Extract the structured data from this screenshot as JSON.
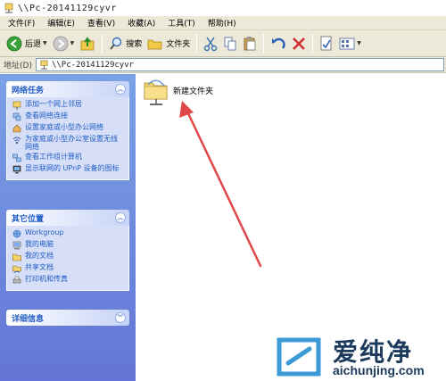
{
  "window": {
    "title": "\\\\Pc-20141129cyvr"
  },
  "menu": {
    "items": [
      "文件(F)",
      "编辑(E)",
      "查看(V)",
      "收藏(A)",
      "工具(T)",
      "帮助(H)"
    ]
  },
  "toolbar": {
    "back_label": "后退",
    "search_label": "搜索",
    "folders_label": "文件夹"
  },
  "address": {
    "label": "地址(D)",
    "value": "\\\\Pc-20141129cyvr"
  },
  "sidebar": {
    "network_tasks": {
      "title": "网络任务",
      "items": [
        {
          "label": "添加一个网上邻居",
          "icon": "add-network-place-icon"
        },
        {
          "label": "查看网络连接",
          "icon": "network-connections-icon"
        },
        {
          "label": "设置家庭或小型办公网络",
          "icon": "home-network-icon"
        },
        {
          "label": "为家庭或小型办公室设置无线网络",
          "icon": "wireless-network-icon"
        },
        {
          "label": "查看工作组计算机",
          "icon": "workgroup-computers-icon"
        },
        {
          "label": "显示联网的 UPnP 设备的图标",
          "icon": "upnp-devices-icon"
        }
      ]
    },
    "other_places": {
      "title": "其它位置",
      "items": [
        {
          "label": "Workgroup",
          "icon": "workgroup-icon"
        },
        {
          "label": "我的电脑",
          "icon": "my-computer-icon"
        },
        {
          "label": "我的文档",
          "icon": "my-documents-icon"
        },
        {
          "label": "共享文档",
          "icon": "shared-documents-icon"
        },
        {
          "label": "打印机和传真",
          "icon": "printers-faxes-icon"
        }
      ]
    },
    "details": {
      "title": "详细信息"
    }
  },
  "content": {
    "folder_label": "新建文件夹"
  },
  "watermark": {
    "brand": "爱纯净",
    "url": "aichunjing.com"
  },
  "colors": {
    "task_pane_top": "#7aa1e6",
    "task_pane_bottom": "#6375d6",
    "link_blue": "#215dc6",
    "arrow_red": "#e04848"
  }
}
